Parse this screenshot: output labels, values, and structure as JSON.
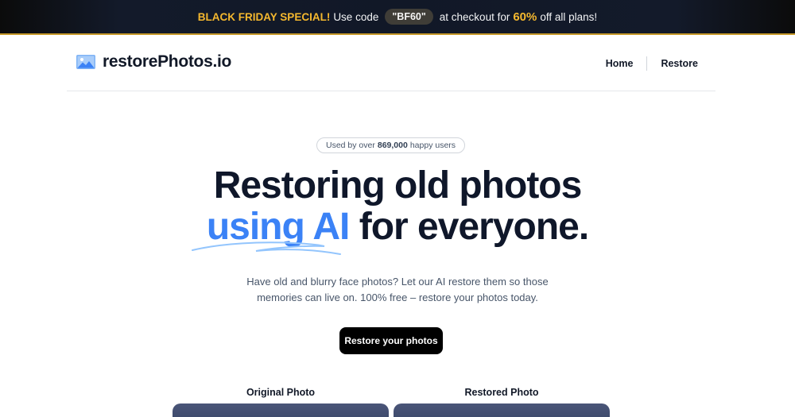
{
  "promo": {
    "special": "BLACK FRIDAY SPECIAL!",
    "use_code": "Use code",
    "code": "\"BF60\"",
    "at_checkout": "at checkout for",
    "discount": "60%",
    "off_all": "off all plans!"
  },
  "header": {
    "brand_name": "restorePhotos.io",
    "nav": {
      "home": "Home",
      "restore": "Restore"
    }
  },
  "hero": {
    "badge_prefix": "Used by over",
    "badge_count": "869,000",
    "badge_suffix": "happy users",
    "title_line1": "Restoring old photos",
    "title_accent": "using AI",
    "title_line2_rest": " for everyone.",
    "subtitle_line1": "Have old and blurry face photos? Let our AI restore them so those",
    "subtitle_line2": "memories can live on. 100% free – restore your photos today.",
    "cta_label": "Restore your photos"
  },
  "comparison": {
    "original_label": "Original Photo",
    "restored_label": "Restored Photo"
  },
  "colors": {
    "accent": "#3b82f6",
    "promo_highlight": "#f5b82e",
    "cta_bg": "#000000"
  },
  "icons": {
    "brand": "photo-icon"
  }
}
